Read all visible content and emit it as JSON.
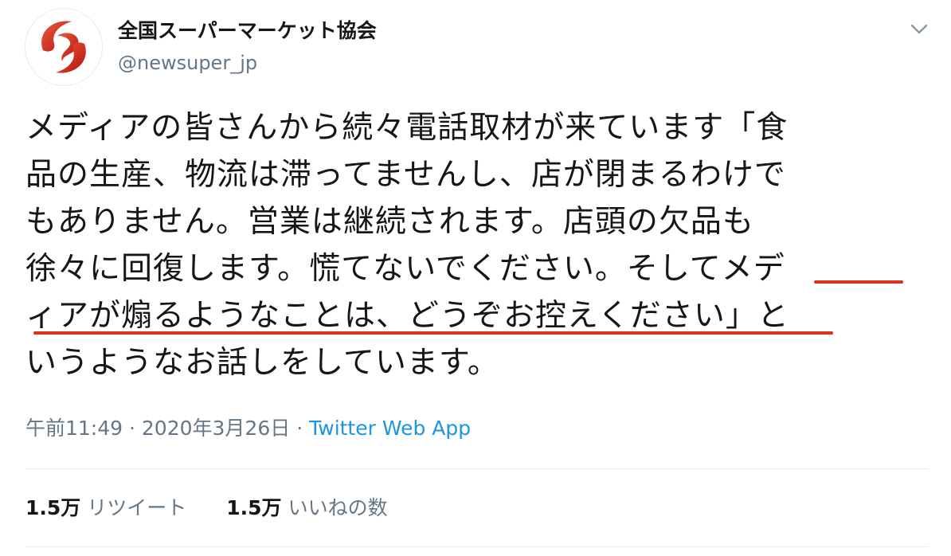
{
  "account": {
    "display_name": "全国スーパーマーケット協会",
    "handle": "@newsuper_jp",
    "avatar_icon": "supermarket-association-logo"
  },
  "header": {
    "menu_icon": "chevron-down-icon"
  },
  "tweet": {
    "lines": [
      "メディアの皆さんから続々電話取材が来ています「食",
      "品の生産、物流は滞ってませんし、店が閉まるわけで",
      "もありません。営業は継続されます。店頭の欠品も",
      "徐々に回復します。慌てないでください。そしてメデ",
      "ィアが煽るようなことは、どうぞお控えください」と",
      "いうようなお話しをしています。"
    ]
  },
  "meta": {
    "time": "午前11:49",
    "separator": "·",
    "date": "2020年3月26日",
    "source": "Twitter Web App"
  },
  "stats": {
    "retweets_count": "1.5万",
    "retweets_label": "リツイート",
    "likes_count": "1.5万",
    "likes_label": "いいねの数"
  },
  "colors": {
    "accent": "#1b95e0",
    "underline_annotation": "#e0301e",
    "logo_red": "#d9231d"
  }
}
